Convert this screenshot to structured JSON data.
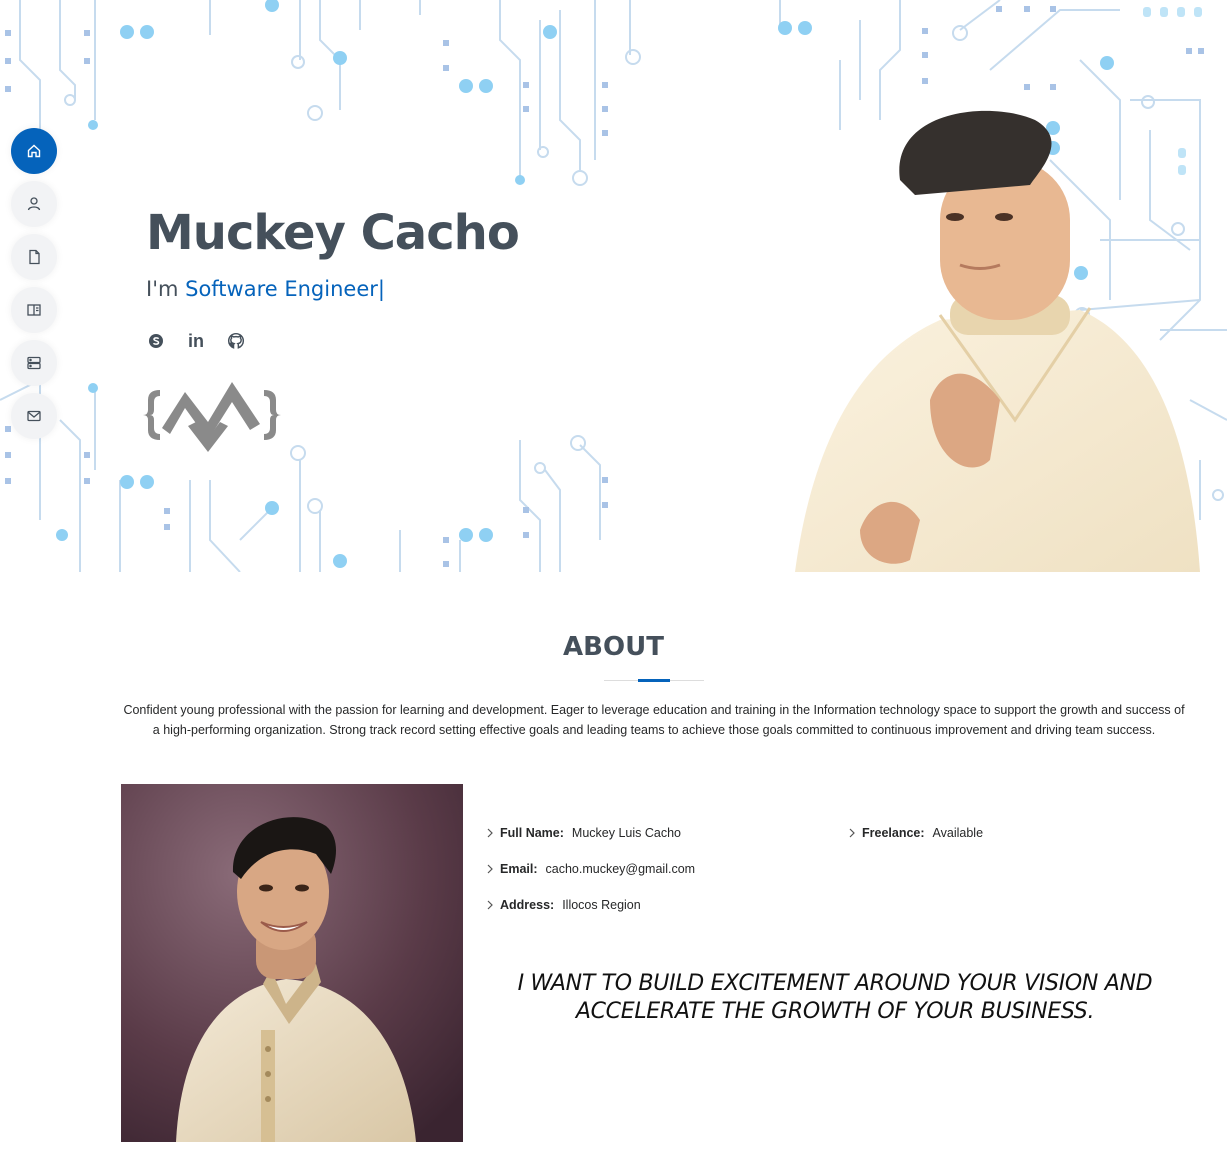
{
  "hero": {
    "name": "Muckey Cacho",
    "intro": "I'm ",
    "role": "Software Engineer",
    "cursor": "|"
  },
  "nav": {
    "items": [
      {
        "icon": "home-icon",
        "active": true
      },
      {
        "icon": "person-icon",
        "active": false
      },
      {
        "icon": "file-icon",
        "active": false
      },
      {
        "icon": "book-icon",
        "active": false
      },
      {
        "icon": "server-icon",
        "active": false
      },
      {
        "icon": "envelope-icon",
        "active": false
      }
    ]
  },
  "socials": [
    {
      "icon": "skype-icon"
    },
    {
      "icon": "linkedin-icon",
      "text": "in"
    },
    {
      "icon": "github-icon"
    }
  ],
  "about": {
    "title": "ABOUT",
    "description": "Confident young professional with the passion for learning and development. Eager to leverage education and training in the Information technology space to support the growth and success of a high-performing organization. Strong track record setting effective goals and leading teams to achieve those goals committed to continuous improvement and driving team success.",
    "info": {
      "full_name_label": "Full Name:",
      "full_name": "Muckey Luis Cacho",
      "freelance_label": "Freelance:",
      "freelance": "Available",
      "email_label": "Email:",
      "email": "cacho.muckey@gmail.com",
      "address_label": "Address:",
      "address": "Illocos Region"
    },
    "tagline": "I WANT TO BUILD EXCITEMENT AROUND YOUR VISION AND ACCELERATE THE GROWTH OF YOUR BUSINESS."
  },
  "colors": {
    "accent": "#0563bb",
    "heading": "#45505b",
    "circuit": "#b7d3ec",
    "circuit_dot": "#8fd0f3"
  }
}
